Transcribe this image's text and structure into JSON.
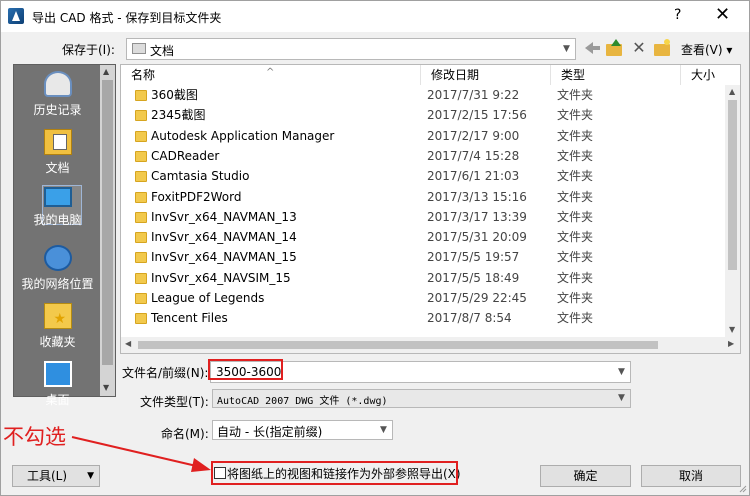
{
  "window": {
    "title": "导出 CAD 格式 - 保存到目标文件夹",
    "help": "?",
    "close": "✕"
  },
  "savein": {
    "label": "保存于(I):",
    "value": "文档",
    "view_menu": "查看(V) ▾"
  },
  "places": [
    {
      "label": "历史记录",
      "icon": "history-icon"
    },
    {
      "label": "文档",
      "icon": "documents-icon"
    },
    {
      "label": "我的电脑",
      "icon": "computer-icon"
    },
    {
      "label": "我的网络位置",
      "icon": "network-icon"
    },
    {
      "label": "收藏夹",
      "icon": "favorites-icon"
    },
    {
      "label": "桌面",
      "icon": "desktop-icon"
    }
  ],
  "filelist": {
    "columns": [
      "名称",
      "修改日期",
      "类型",
      "大小"
    ],
    "rows": [
      {
        "name": "360截图",
        "date": "2017/7/31 9:22",
        "type": "文件夹"
      },
      {
        "name": "2345截图",
        "date": "2017/2/15 17:56",
        "type": "文件夹"
      },
      {
        "name": "Autodesk Application Manager",
        "date": "2017/2/17 9:00",
        "type": "文件夹"
      },
      {
        "name": "CADReader",
        "date": "2017/7/4 15:28",
        "type": "文件夹"
      },
      {
        "name": "Camtasia Studio",
        "date": "2017/6/1 21:03",
        "type": "文件夹"
      },
      {
        "name": "FoxitPDF2Word",
        "date": "2017/3/13 15:16",
        "type": "文件夹"
      },
      {
        "name": "InvSvr_x64_NAVMAN_13",
        "date": "2017/3/17 13:39",
        "type": "文件夹"
      },
      {
        "name": "InvSvr_x64_NAVMAN_14",
        "date": "2017/5/31 20:09",
        "type": "文件夹"
      },
      {
        "name": "InvSvr_x64_NAVMAN_15",
        "date": "2017/5/5 19:57",
        "type": "文件夹"
      },
      {
        "name": "InvSvr_x64_NAVSIM_15",
        "date": "2017/5/5 18:49",
        "type": "文件夹"
      },
      {
        "name": "League of Legends",
        "date": "2017/5/29 22:45",
        "type": "文件夹"
      },
      {
        "name": "Tencent Files",
        "date": "2017/8/7 8:54",
        "type": "文件夹"
      }
    ]
  },
  "filename": {
    "label": "文件名/前缀(N):",
    "value": "3500-3600"
  },
  "filetype": {
    "label": "文件类型(T):",
    "value": "AutoCAD 2007 DWG 文件  (*.dwg)"
  },
  "naming": {
    "label": "命名(M):",
    "value": "自动 - 长(指定前缀)"
  },
  "bottom": {
    "tools": "工具(L)",
    "export_option": "将图纸上的视图和链接作为外部参照导出(X)",
    "ok": "确定",
    "cancel": "取消"
  },
  "annotation": {
    "text": "不勾选",
    "color": "#e02020"
  }
}
